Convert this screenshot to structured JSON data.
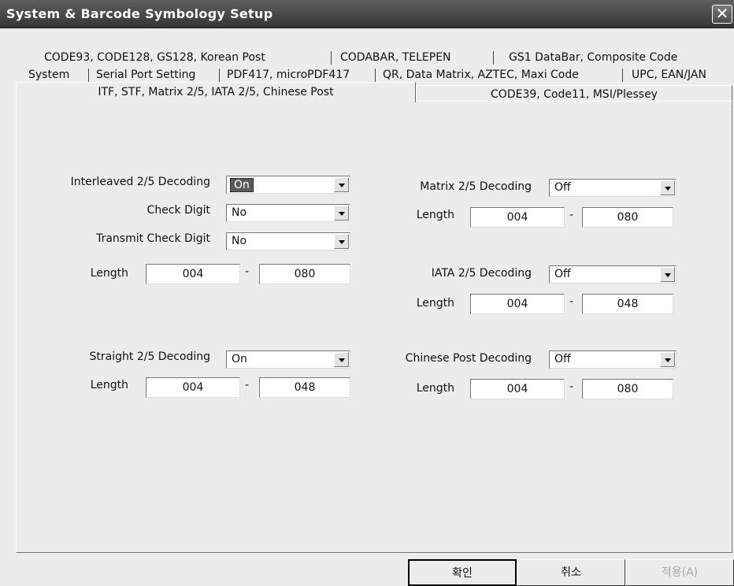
{
  "window": {
    "title": "System & Barcode Symbology Setup",
    "close_glyph": "✕"
  },
  "tabs": {
    "row1": [
      "CODE93, CODE128, GS128, Korean Post",
      "CODABAR, TELEPEN",
      "GS1 DataBar, Composite Code"
    ],
    "row2": [
      "System",
      "Serial Port Setting",
      "PDF417, microPDF417",
      "QR, Data Matrix, AZTEC, Maxi Code",
      "UPC, EAN/JAN"
    ],
    "row3": [
      "ITF, STF, Matrix 2/5, IATA 2/5, Chinese Post",
      "CODE39, Code11, MSI/Plessey"
    ]
  },
  "left": {
    "i25": {
      "label": "Interleaved 2/5 Decoding",
      "value": "On"
    },
    "check_digit": {
      "label": "Check Digit",
      "value": "No"
    },
    "transmit_check": {
      "label": "Transmit Check Digit",
      "value": "No"
    },
    "i25_length": {
      "label": "Length",
      "min": "004",
      "max": "080"
    },
    "s25": {
      "label": "Straight 2/5 Decoding",
      "value": "On"
    },
    "s25_length": {
      "label": "Length",
      "min": "004",
      "max": "048"
    }
  },
  "right": {
    "m25": {
      "label": "Matrix 2/5 Decoding",
      "value": "Off"
    },
    "m25_length": {
      "label": "Length",
      "min": "004",
      "max": "080"
    },
    "iata": {
      "label": "IATA 2/5 Decoding",
      "value": "Off"
    },
    "iata_length": {
      "label": "Length",
      "min": "004",
      "max": "048"
    },
    "cp": {
      "label": "Chinese Post Decoding",
      "value": "Off"
    },
    "cp_length": {
      "label": "Length",
      "min": "004",
      "max": "080"
    }
  },
  "range_dash": "-",
  "buttons": {
    "ok": "확인",
    "cancel": "취소",
    "apply": "적용(A)"
  }
}
